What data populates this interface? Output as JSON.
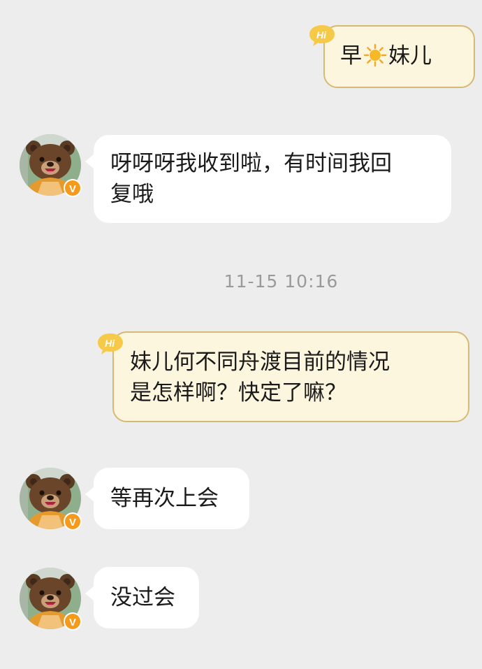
{
  "messages": [
    {
      "direction": "out",
      "badge": "Hi",
      "text_before": "早",
      "icon": "sun-icon",
      "text_after": "妹儿"
    },
    {
      "direction": "in",
      "avatar": "bear-avatar",
      "verified_badge": "V",
      "lines": [
        "呀呀呀我收到啦，有时间我回",
        "复哦"
      ]
    },
    {
      "direction": "out",
      "badge": "Hi",
      "lines": [
        "妹儿何不同舟渡目前的情况",
        "是怎样啊？快定了嘛？"
      ]
    },
    {
      "direction": "in",
      "avatar": "bear-avatar",
      "verified_badge": "V",
      "lines": [
        "等再次上会"
      ]
    },
    {
      "direction": "in",
      "avatar": "bear-avatar",
      "verified_badge": "V",
      "lines": [
        "没过会"
      ]
    }
  ],
  "timestamp": "11-15 10:16",
  "colors": {
    "background": "#ededed",
    "out_bubble_fill": "#fdf6de",
    "out_bubble_border": "#d8b877",
    "badge_yellow": "#f7c948",
    "verified_orange": "#f59a1b",
    "timestamp_text": "#9a9a9a"
  }
}
